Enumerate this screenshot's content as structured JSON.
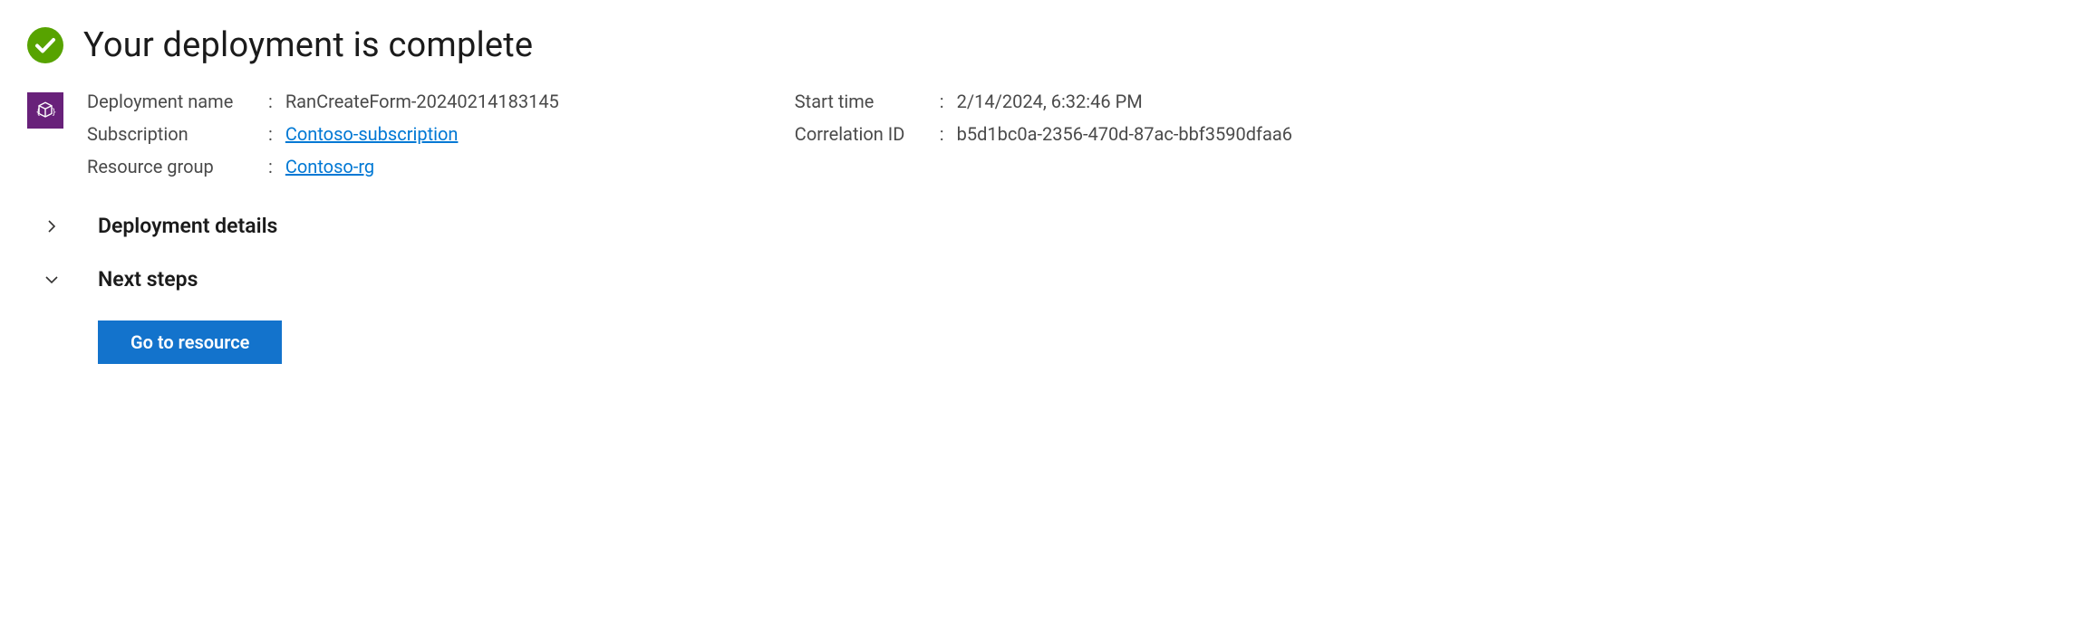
{
  "header": {
    "title": "Your deployment is complete"
  },
  "details": {
    "left": {
      "deployment_name_label": "Deployment name",
      "deployment_name_value": "RanCreateForm-20240214183145",
      "subscription_label": "Subscription",
      "subscription_value": "Contoso-subscription",
      "resource_group_label": "Resource group",
      "resource_group_value": "Contoso-rg"
    },
    "right": {
      "start_time_label": "Start time",
      "start_time_value": "2/14/2024, 6:32:46 PM",
      "correlation_id_label": "Correlation ID",
      "correlation_id_value": "b5d1bc0a-2356-470d-87ac-bbf3590dfaa6"
    }
  },
  "sections": {
    "deployment_details": "Deployment details",
    "next_steps": "Next steps"
  },
  "actions": {
    "go_to_resource": "Go to resource"
  }
}
